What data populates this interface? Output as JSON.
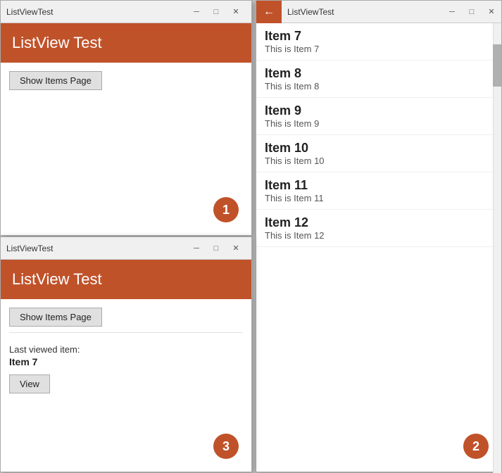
{
  "window1": {
    "title": "ListViewTest",
    "header_title": "ListView Test",
    "show_items_btn": "Show Items Page",
    "badge": "1",
    "controls": {
      "minimize": "─",
      "maximize": "□",
      "close": "✕"
    }
  },
  "window2": {
    "title": "ListViewTest",
    "badge": "2",
    "controls": {
      "back": "←",
      "minimize": "─",
      "maximize": "□",
      "close": "✕"
    },
    "items": [
      {
        "title": "Item 7",
        "subtitle": "This is Item 7"
      },
      {
        "title": "Item 8",
        "subtitle": "This is Item 8"
      },
      {
        "title": "Item 9",
        "subtitle": "This is Item 9"
      },
      {
        "title": "Item 10",
        "subtitle": "This is Item 10"
      },
      {
        "title": "Item 11",
        "subtitle": "This is Item 11"
      },
      {
        "title": "Item 12",
        "subtitle": "This is Item 12"
      }
    ]
  },
  "window3": {
    "title": "ListViewTest",
    "header_title": "ListView Test",
    "show_items_btn": "Show Items Page",
    "last_viewed_label": "Last viewed item:",
    "last_viewed_item": "Item 7",
    "view_btn": "View",
    "badge": "3",
    "controls": {
      "minimize": "─",
      "maximize": "□",
      "close": "✕"
    }
  }
}
